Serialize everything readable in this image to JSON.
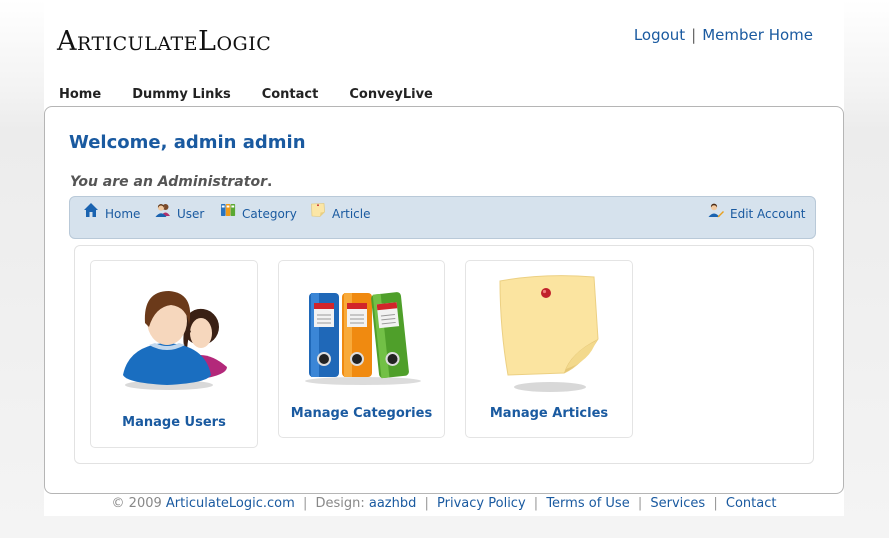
{
  "header": {
    "logo": "ArticulateLogic",
    "logout_label": "Logout",
    "separator": "|",
    "member_home_label": "Member Home"
  },
  "nav": {
    "items": [
      {
        "label": "Home"
      },
      {
        "label": "Dummy Links"
      },
      {
        "label": "Contact"
      },
      {
        "label": "ConveyLive"
      }
    ]
  },
  "main": {
    "welcome": "Welcome, admin admin",
    "role_text": "You are an Administrator",
    "role_period": "."
  },
  "toolbar": {
    "home_label": "Home",
    "user_label": "User",
    "category_label": "Category",
    "article_label": "Article",
    "edit_account_label": "Edit Account"
  },
  "cards": [
    {
      "label": "Manage Users",
      "icon": "users-icon"
    },
    {
      "label": "Manage Categories",
      "icon": "binders-icon"
    },
    {
      "label": "Manage Articles",
      "icon": "sticky-note-icon"
    }
  ],
  "footer": {
    "copyright": "© 2009",
    "site_link": "ArticulateLogic.com",
    "design_label": "Design:",
    "designer_link": "aazhbd",
    "privacy_link": "Privacy Policy",
    "terms_link": "Terms of Use",
    "services_link": "Services",
    "contact_link": "Contact",
    "separator": "|"
  },
  "colors": {
    "link": "#1a5aa0",
    "toolbar_bg": "#d6e2ed"
  }
}
